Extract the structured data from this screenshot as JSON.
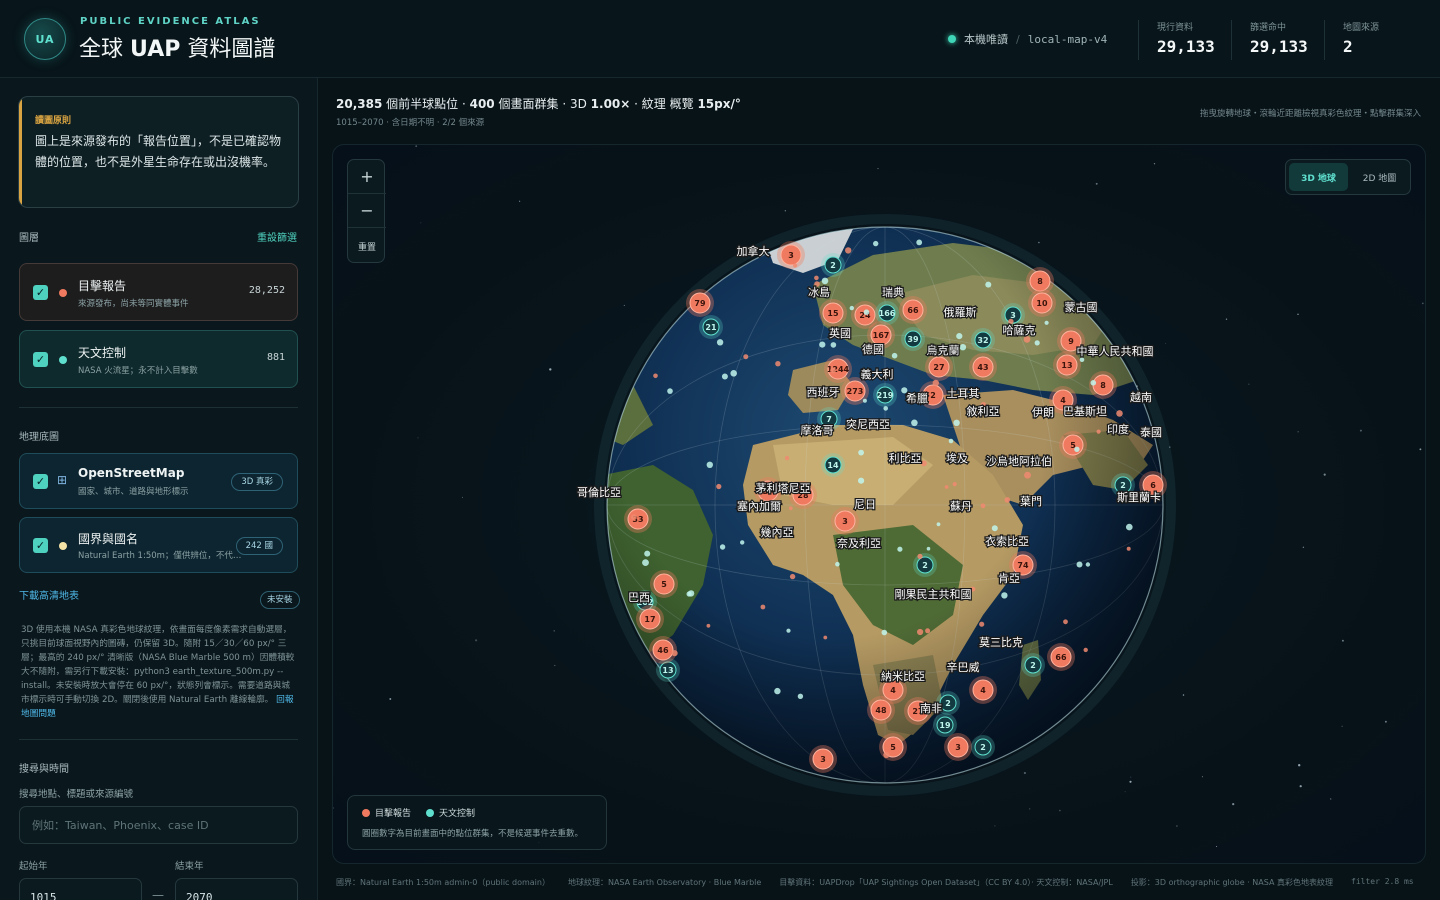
{
  "header": {
    "logo_text": "UA",
    "kicker": "PUBLIC EVIDENCE ATLAS",
    "title_pre": "全球",
    "title_bold": "UAP",
    "title_post": "資料圖譜",
    "status_label": "本機唯讀",
    "status_sep": "/",
    "status_source": "local-map-v4",
    "stats": [
      {
        "label": "現行資料",
        "value": "29,133"
      },
      {
        "label": "篩選命中",
        "value": "29,133"
      },
      {
        "label": "地圖來源",
        "value": "2"
      }
    ]
  },
  "sidebar": {
    "notice_title": "讀圖原則",
    "notice_text": "圖上是來源發布的「報告位置」，不是已確認物體的位置，也不是外星生命存在或出沒機率。",
    "layers_heading": "圖層",
    "reset_link": "重設篩選",
    "layers": [
      {
        "name": "目擊報告",
        "desc": "來源發布，尚未等同實體事件",
        "count": "28,252",
        "color": "#f07a5f"
      },
      {
        "name": "天文控制",
        "desc": "NASA 火流星；永不計入目擊數",
        "count": "881",
        "color": "#5fe0cf"
      }
    ],
    "basemap_heading": "地理底圖",
    "basemaps": [
      {
        "name": "OpenStreetMap",
        "desc": "國家、城市、道路與地形標示",
        "pill": "3D 真彩",
        "icon": "grid-icon"
      },
      {
        "name": "國界與國名",
        "desc": "Natural Earth 1:50m；僅供辨位，不代表政治立場",
        "pill": "242 國",
        "icon": "dot-icon"
      }
    ],
    "download_link": "下載高清地表",
    "download_pill": "未安裝",
    "help_text": "3D 使用本機 NASA 真彩色地球紋理，依畫面每度像素需求自動選層，只挑目前球面視野內的圖磚，仍保留 3D。隨附 15／30／60 px/° 三層；最高的 240 px/° 清晰版（NASA Blue Marble 500 m）因體積較大不隨附，需另行下載安裝：python3 earth_texture_500m.py --install。未安裝時放大會停在 60 px/°，狀態列會標示。需要道路與城市標示時可手動切換 2D。關閉後使用 Natural Earth 離線輪廓。",
    "help_link": "回報地圖問題",
    "search_heading": "搜尋與時間",
    "search_label": "搜尋地點、標題或來源編號",
    "search_placeholder": "例如：Taiwan、Phoenix、case ID",
    "start_label": "起始年",
    "end_label": "結束年",
    "start_value": "1015",
    "end_value": "2070",
    "year_dash": "—"
  },
  "main": {
    "summary_points": "20,385",
    "summary_text1": "個前半球點位 ·",
    "summary_clusters": "400",
    "summary_text2": "個畫面群集 · 3D",
    "summary_zoom": "1.00×",
    "summary_text3": "· 紋理 概覽",
    "summary_tex": "15px/°",
    "sub": "1015–2070 · 含日期不明 · 2/2 個來源",
    "hint": "拖曳旋轉地球・滾輪近距離檢視真彩色紋理・點擊群集深入",
    "zoom_in": "+",
    "zoom_out": "−",
    "zoom_reset": "重置",
    "toggle_3d": "3D 地球",
    "toggle_2d": "2D 地圖",
    "legend_reports": "目擊報告",
    "legend_astro": "天文控制",
    "legend_note": "圓圈數字為目前畫面中的點位群集，不是候選事件去重數。",
    "country_labels": [
      "加拿大",
      "冰島",
      "瑞典",
      "俄羅斯",
      "蒙古國",
      "哈薩克",
      "中華人民共和國",
      "英國",
      "德國",
      "烏克蘭",
      "義大利",
      "西班牙",
      "希臘",
      "土耳其",
      "敘利亞",
      "伊朗",
      "巴基斯坦",
      "印度",
      "越南",
      "泰國",
      "摩洛哥",
      "突尼西亞",
      "利比亞",
      "埃及",
      "沙烏地阿拉伯",
      "葉門",
      "斯里蘭卡",
      "哥倫比亞",
      "茅利塔尼亞",
      "塞內加爾",
      "尼日",
      "蘇丹",
      "幾內亞",
      "奈及利亞",
      "衣索比亞",
      "肯亞",
      "剛果民主共和國",
      "巴西",
      "莫三比克",
      "辛巴威",
      "納米比亞",
      "南非"
    ],
    "cluster_numbers": [
      "13",
      "79",
      "21",
      "4",
      "3",
      "2",
      "15",
      "24",
      "166",
      "66",
      "167",
      "39",
      "1244",
      "273",
      "219",
      "27",
      "43",
      "32",
      "8",
      "10",
      "2",
      "9",
      "13",
      "7",
      "2",
      "4",
      "2",
      "33",
      "5",
      "102",
      "17",
      "6",
      "13",
      "46",
      "27",
      "19",
      "48",
      "66",
      "2",
      "4",
      "3",
      "2",
      "5",
      "3",
      "2",
      "74",
      "28",
      "14",
      "57",
      "4",
      "3",
      "5",
      "4",
      "2",
      "6",
      "8",
      "2",
      "3"
    ]
  },
  "footer": [
    "國界：Natural Earth 1:50m admin-0（public domain）",
    "地球紋理：NASA Earth Observatory · Blue Marble",
    "目擊資料：UAPDrop「UAP Sightings Open Dataset」（CC BY 4.0）· 天文控制：NASA/JPL",
    "投影：3D orthographic globe · NASA 真彩色地表紋理",
    "filter 2.8 ms"
  ],
  "colors": {
    "accent": "#4fd1bf",
    "report": "#f07a5f",
    "astro": "#5fe0cf",
    "warn": "#d9a441"
  }
}
